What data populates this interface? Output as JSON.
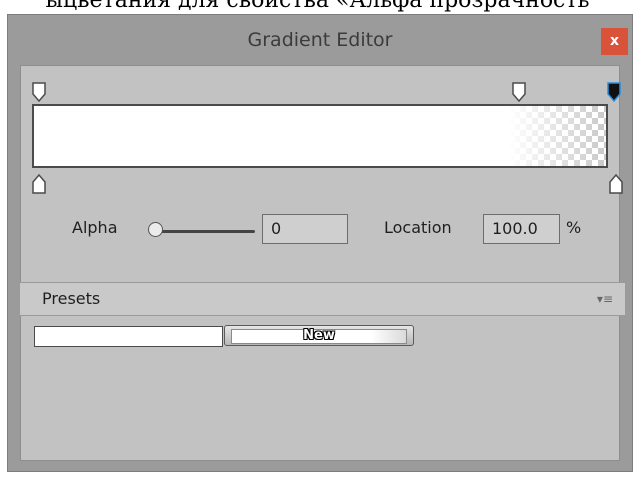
{
  "page": {
    "caption": "ыцветания для свойства «Альфа прозрачность"
  },
  "window": {
    "title": "Gradient Editor",
    "close_label": "x"
  },
  "alpha": {
    "label": "Alpha",
    "value": "0",
    "slider_level": 0
  },
  "location": {
    "label": "Location",
    "value": "100.0",
    "unit": "%"
  },
  "presets": {
    "label": "Presets",
    "menu_icon": "▾≡",
    "new_label": "New"
  }
}
